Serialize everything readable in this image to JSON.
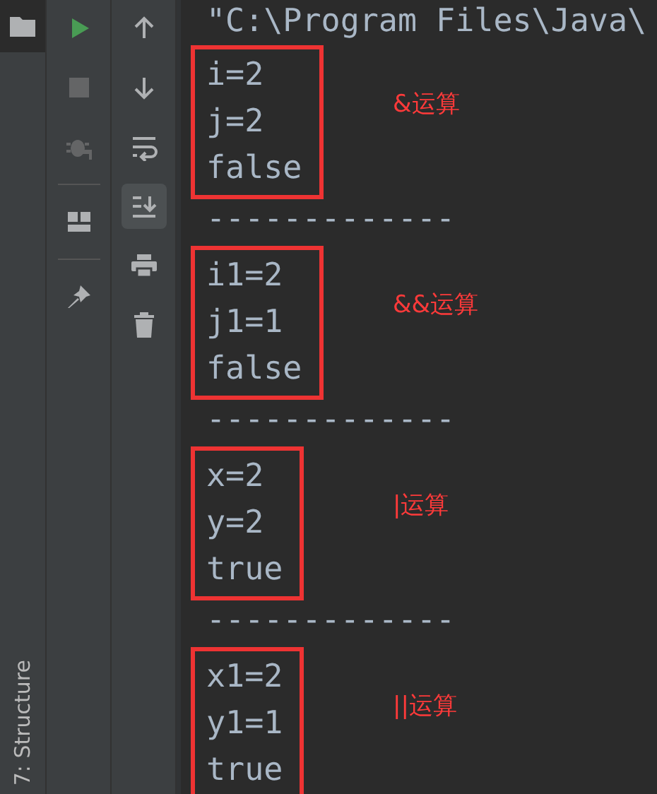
{
  "side_strip": {
    "tab_selected": true,
    "vertical_tab": "7: Structure"
  },
  "run_toolbar": {
    "groups": [
      [
        {
          "kind": "run",
          "disabled": false
        },
        {
          "kind": "stop",
          "disabled": true
        },
        {
          "kind": "debug",
          "disabled": true
        }
      ],
      [
        {
          "kind": "layout",
          "disabled": false
        }
      ],
      [
        {
          "kind": "pin",
          "disabled": false
        }
      ]
    ]
  },
  "console_toolbar": [
    {
      "kind": "up",
      "selected": false
    },
    {
      "kind": "down",
      "selected": false
    },
    {
      "kind": "wrap",
      "selected": false
    },
    {
      "kind": "scroll_end",
      "selected": true
    },
    {
      "kind": "print",
      "selected": false
    },
    {
      "kind": "clear",
      "selected": false
    }
  ],
  "console": {
    "header": "\"C:\\Program Files\\Java\\",
    "blocks": [
      {
        "lines": [
          "i=2",
          "j=2",
          "false"
        ],
        "annotation": "&运算",
        "separator": "-------------"
      },
      {
        "lines": [
          "i1=2",
          "j1=1",
          "false"
        ],
        "annotation": "&&运算",
        "separator": "-------------"
      },
      {
        "lines": [
          "x=2",
          "y=2",
          "true"
        ],
        "annotation": "|运算",
        "separator": "-------------"
      },
      {
        "lines": [
          "x1=2",
          "y1=1",
          "true"
        ],
        "annotation": "||运算"
      }
    ]
  }
}
